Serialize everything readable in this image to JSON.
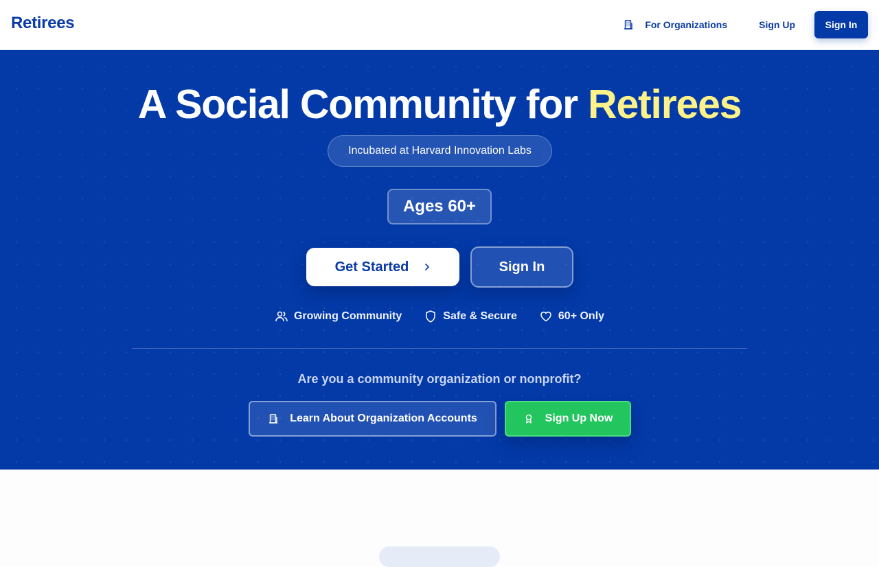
{
  "header": {
    "logo": "Retirees",
    "nav": {
      "for_organizations": "For Organizations",
      "sign_up": "Sign Up",
      "sign_in": "Sign In"
    }
  },
  "hero": {
    "title_main": "A Social Community for ",
    "title_accent": "Retirees",
    "badge": "Incubated at Harvard Innovation Labs",
    "age_badge": "Ages 60+",
    "get_started": "Get Started",
    "sign_in": "Sign In",
    "features": [
      {
        "icon": "users-icon",
        "label": "Growing Community"
      },
      {
        "icon": "shield-icon",
        "label": "Safe & Secure"
      },
      {
        "icon": "heart-icon",
        "label": "60+ Only"
      }
    ],
    "org_question": "Are you a community organization or nonprofit?",
    "learn_button": "Learn About Organization Accounts",
    "signup_now_button": "Sign Up Now"
  },
  "colors": {
    "brand_blue": "#033aa8",
    "accent_yellow": "#fdf28a",
    "success_green": "#22c55e"
  }
}
